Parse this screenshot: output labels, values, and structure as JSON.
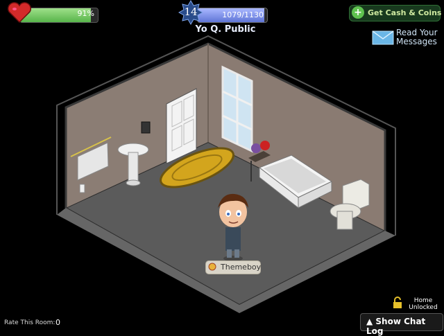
{
  "hud": {
    "health_percent_label": "91%",
    "health_fraction": 0.91,
    "level": "14",
    "xp_label": "1079/1130",
    "xp_fraction": 0.955,
    "player_name": "Yo Q. Public"
  },
  "buttons": {
    "get_cash_label": "Get Cash & Coins",
    "read_messages_label_line1": "Read Your",
    "read_messages_label_line2": "Messages",
    "show_chat_log_label": "▲ Show Chat Log"
  },
  "avatar": {
    "name": "Themeboy"
  },
  "footer": {
    "rate_label": "Rate This Room:",
    "rate_value": "0",
    "home_line1": "Home",
    "home_line2": "Unlocked"
  },
  "colors": {
    "wall": "#8a7c73",
    "floor": "#5a5a5a",
    "health": "#6fc45a",
    "xp": "#7a8ff0"
  }
}
